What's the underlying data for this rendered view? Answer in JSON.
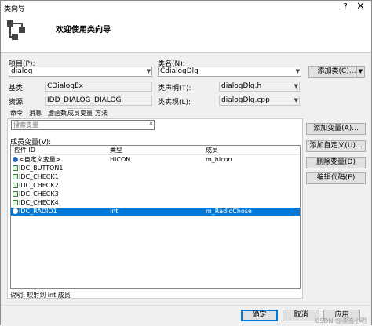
{
  "window": {
    "title": "类向导",
    "help_symbol": "?",
    "close_symbol": "✕",
    "header_title": "欢迎使用类向导",
    "header_icon": "class-diagram-icon"
  },
  "project": {
    "label": "项目(P):",
    "value": "dialog"
  },
  "class_name": {
    "label": "类名(N):",
    "value": "CdialogDlg"
  },
  "add_class": {
    "label": "添加类(C)..."
  },
  "base": {
    "label": "基类:",
    "value": "CDialogEx"
  },
  "resource": {
    "label": "资源:",
    "value": "IDD_DIALOG_DIALOG"
  },
  "class_decl": {
    "label": "类声明(T):",
    "value": "dialogDlg.h"
  },
  "class_impl": {
    "label": "类实现(L):",
    "value": "dialogDlg.cpp"
  },
  "tabs": [
    "命令",
    "消息",
    "虚函数",
    "成员变量",
    "方法"
  ],
  "active_tab": "成员变量",
  "search": {
    "placeholder": "搜索变量"
  },
  "members": {
    "label": "成员变量(V):",
    "columns": [
      "控件 ID",
      "类型",
      "成员"
    ],
    "rows": [
      {
        "id": "<自定义变量>",
        "type": "HICON",
        "member": "m_hIcon",
        "icon": "variable-icon",
        "selected": false
      },
      {
        "id": "IDC_BUTTON1",
        "type": "",
        "member": "",
        "icon": "control-icon",
        "selected": false
      },
      {
        "id": "IDC_CHECK1",
        "type": "",
        "member": "",
        "icon": "control-icon",
        "selected": false
      },
      {
        "id": "IDC_CHECK2",
        "type": "",
        "member": "",
        "icon": "control-icon",
        "selected": false
      },
      {
        "id": "IDC_CHECK3",
        "type": "",
        "member": "",
        "icon": "control-icon",
        "selected": false
      },
      {
        "id": "IDC_CHECK4",
        "type": "",
        "member": "",
        "icon": "control-icon",
        "selected": false
      },
      {
        "id": "IDC_RADIO1",
        "type": "int",
        "member": "m_RadioChose",
        "icon": "variable-icon",
        "selected": true
      }
    ]
  },
  "side_buttons": {
    "add_variable": "添加变量(A)...",
    "add_custom": "添加自定义(U)...",
    "delete_variable": "删除变量(D)",
    "edit_code": "编辑代码(E)"
  },
  "description": "说明:   映射到 int 成员",
  "footer": {
    "ok": "确定",
    "cancel": "取消",
    "apply": "应用"
  },
  "watermark": "CSDN @漂流小明",
  "colors": {
    "selection": "#0078d7",
    "primary_border": "#0078d7"
  }
}
